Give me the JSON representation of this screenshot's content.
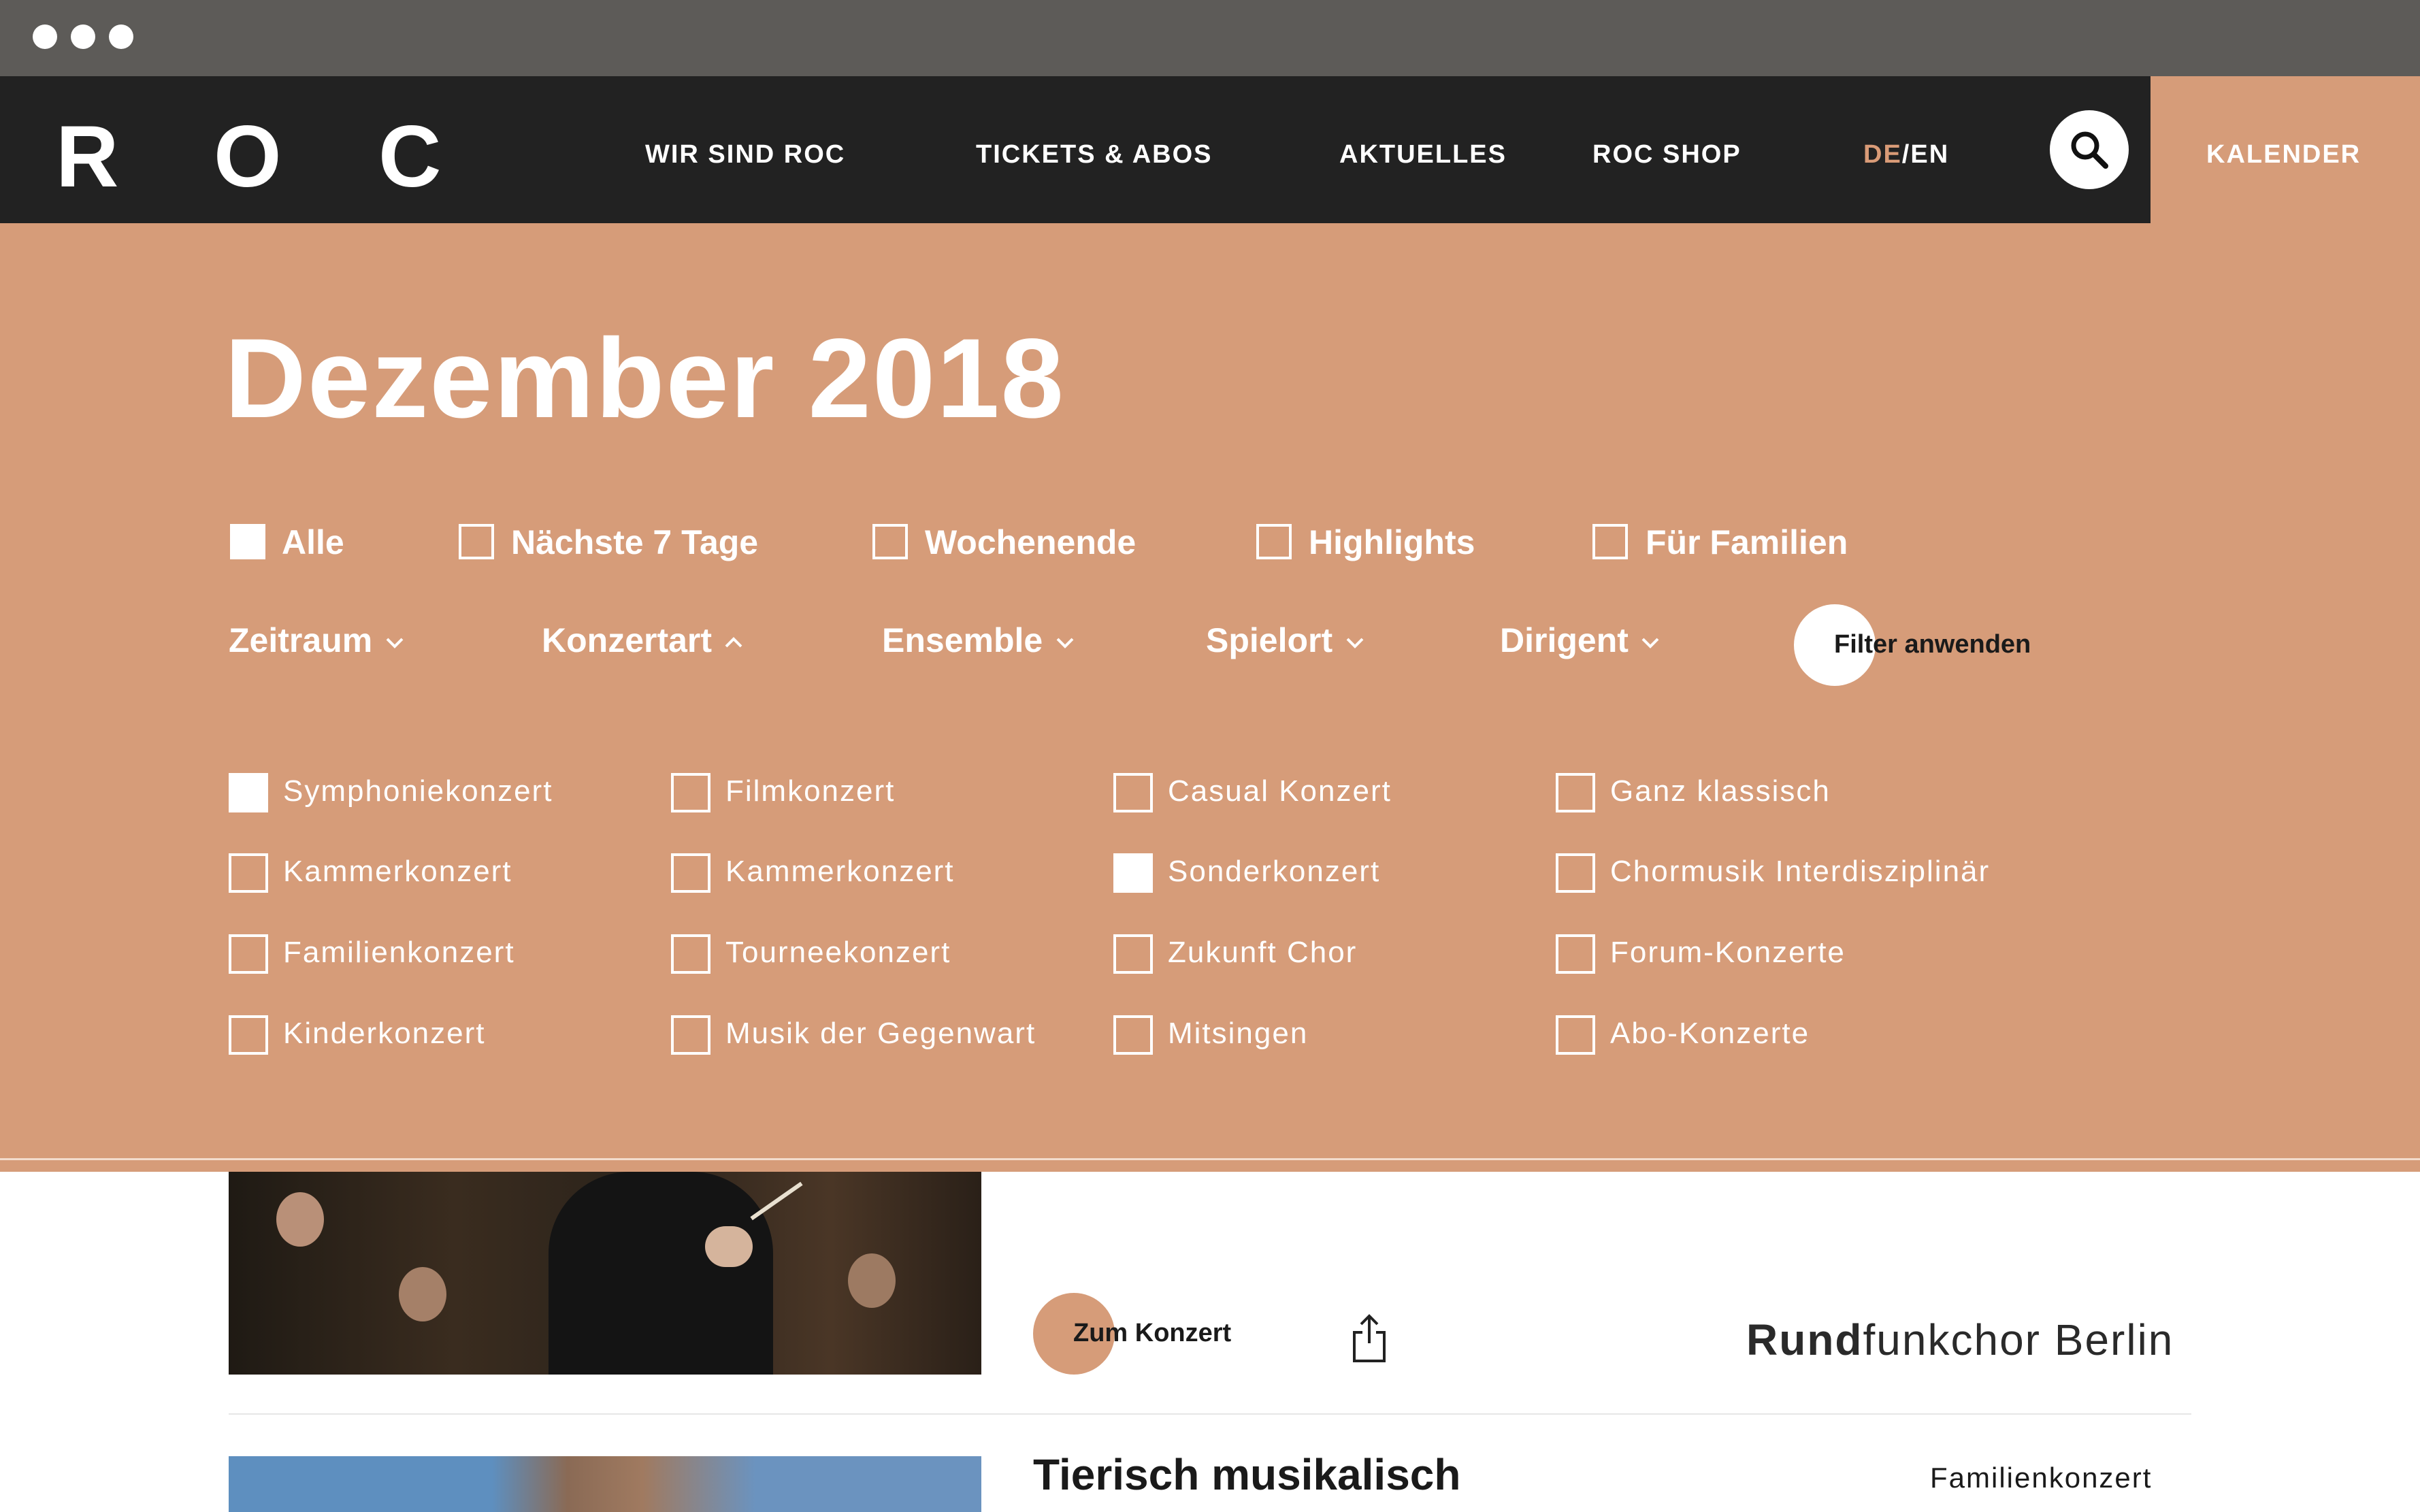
{
  "header": {
    "logo_letters": [
      "R",
      "O",
      "C"
    ],
    "nav": [
      "WIR SIND ROC",
      "TICKETS & ABOS",
      "AKTUELLES",
      "ROC SHOP"
    ],
    "lang_de": "DE",
    "lang_sep": "/",
    "lang_en": "EN",
    "calendar_label": "KALENDER"
  },
  "calendar": {
    "month_title": "Dezember 2018",
    "quick_filters": [
      {
        "label": "Alle",
        "checked": true
      },
      {
        "label": "Nächste 7 Tage",
        "checked": false
      },
      {
        "label": "Wochenende",
        "checked": false
      },
      {
        "label": "Highlights",
        "checked": false
      },
      {
        "label": "Für Familien",
        "checked": false
      }
    ],
    "dropdowns": [
      {
        "label": "Zeitraum",
        "open": false
      },
      {
        "label": "Konzertart",
        "open": true
      },
      {
        "label": "Ensemble",
        "open": false
      },
      {
        "label": "Spielort",
        "open": false
      },
      {
        "label": "Dirigent",
        "open": false
      }
    ],
    "apply_label": "Filter anwenden",
    "concert_types": [
      [
        {
          "label": "Symphoniekonzert",
          "checked": true
        },
        {
          "label": "Kammerkonzert",
          "checked": false
        },
        {
          "label": "Familienkonzert",
          "checked": false
        },
        {
          "label": "Kinderkonzert",
          "checked": false
        }
      ],
      [
        {
          "label": "Filmkonzert",
          "checked": false
        },
        {
          "label": "Kammerkonzert",
          "checked": false
        },
        {
          "label": "Tourneekonzert",
          "checked": false
        },
        {
          "label": "Musik der Gegenwart",
          "checked": false
        }
      ],
      [
        {
          "label": "Casual Konzert",
          "checked": false
        },
        {
          "label": "Sonderkonzert",
          "checked": true
        },
        {
          "label": "Zukunft Chor",
          "checked": false
        },
        {
          "label": "Mitsingen",
          "checked": false
        }
      ],
      [
        {
          "label": "Ganz klassisch",
          "checked": false
        },
        {
          "label": "Chormusik Interdisziplinär",
          "checked": false
        },
        {
          "label": "Forum-Konzerte",
          "checked": false
        },
        {
          "label": "Abo-Konzerte",
          "checked": false
        }
      ]
    ]
  },
  "events": {
    "first": {
      "cta_label": "Zum Konzert",
      "ensemble_bold": "Rund",
      "ensemble_rest": "funkchor Berlin"
    },
    "second": {
      "title": "Tierisch musikalisch",
      "type": "Familienkonzert"
    }
  },
  "colors": {
    "accent": "#d69c79",
    "header_bg": "#222222",
    "chrome_bg": "#5d5b58"
  },
  "icons": [
    "search-icon",
    "chevron-down-icon",
    "chevron-up-icon",
    "share-icon"
  ]
}
